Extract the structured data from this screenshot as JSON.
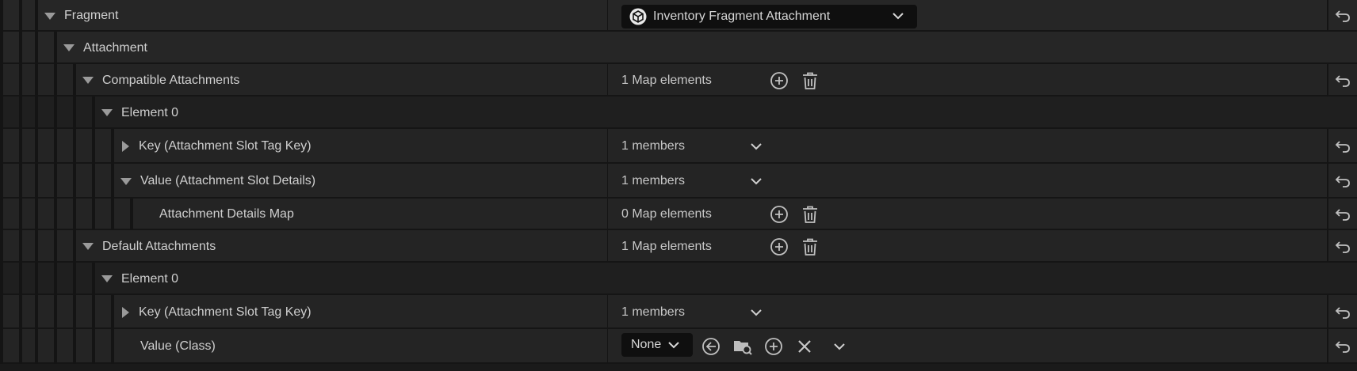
{
  "rows": {
    "fragment": {
      "label": "Fragment",
      "value": "Inventory Fragment Attachment"
    },
    "attachment": {
      "label": "Attachment"
    },
    "compatible": {
      "label": "Compatible Attachments",
      "value": "1 Map elements"
    },
    "element0a": {
      "label": "Element 0"
    },
    "keyA": {
      "label": "Key (Attachment Slot Tag Key)",
      "value": "1 members"
    },
    "valueA": {
      "label": "Value (Attachment Slot Details)",
      "value": "1 members"
    },
    "detailsMap": {
      "label": "Attachment Details Map",
      "value": "0 Map elements"
    },
    "defaults": {
      "label": "Default Attachments",
      "value": "1 Map elements"
    },
    "element0b": {
      "label": "Element 0"
    },
    "keyB": {
      "label": "Key (Attachment Slot Tag Key)",
      "value": "1 members"
    },
    "valueClass": {
      "label": "Value (Class)",
      "value": "None"
    }
  },
  "icons": {
    "reset": "reset-to-default-icon",
    "add": "plus-circle-icon",
    "delete": "trash-icon",
    "expand": "chevron-down-icon",
    "asset": "cube-icon",
    "browse": "arrow-left-circle-icon",
    "find": "folder-search-icon",
    "clear": "x-icon"
  },
  "colors": {
    "panel_bg": "#1a1a1a",
    "row_bg_group": "#262626",
    "row_bg_property": "#242424",
    "row_bg_element": "#1f1f1f",
    "text": "#c8c8c8",
    "icon": "#c0c0c0",
    "combo_bg": "#0f0f0f"
  }
}
